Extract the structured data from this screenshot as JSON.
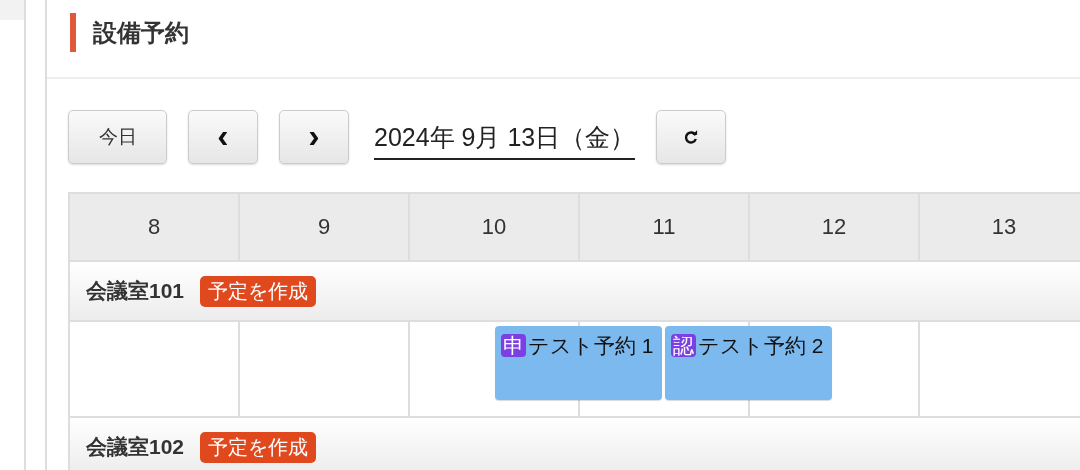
{
  "page": {
    "title": "設備予約"
  },
  "toolbar": {
    "today": "今日",
    "prev": "‹",
    "next": "›",
    "date": "2024年 9月 13日（金）"
  },
  "hours": [
    "8",
    "9",
    "10",
    "11",
    "12",
    "13"
  ],
  "rooms": [
    {
      "name": "会議室101",
      "create": "予定を作成",
      "events": [
        {
          "badge": "申",
          "title": "テスト予約 1"
        },
        {
          "badge": "認",
          "title": "テスト予約 2"
        }
      ]
    },
    {
      "name": "会議室102",
      "create": "予定を作成"
    }
  ]
}
